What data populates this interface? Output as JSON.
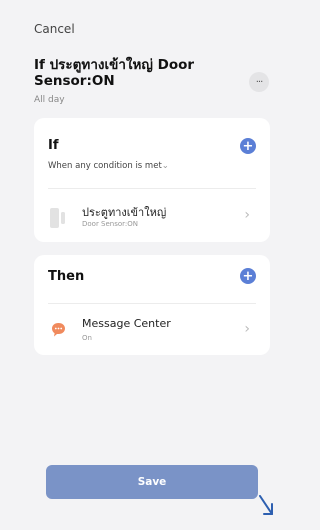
{
  "header": {
    "cancel_label": "Cancel",
    "title": "If ประตูทางเข้าใหญ่ Door Sensor:ON",
    "subtitle": "All day",
    "more_label": "..."
  },
  "if_section": {
    "heading": "If",
    "condition_mode": "When any condition is met",
    "condition_caret": "⌄",
    "items": [
      {
        "title": "ประตูทางเข้าใหญ่",
        "subtitle": "Door Sensor:ON",
        "icon": "door-sensor-icon"
      }
    ]
  },
  "then_section": {
    "heading": "Then",
    "items": [
      {
        "title": "Message Center",
        "subtitle": "On",
        "icon": "message-icon"
      }
    ]
  },
  "save_label": "Save",
  "colors": {
    "accent": "#5b7fd6",
    "save_button": "#7a93c7",
    "message_icon": "#f08a5d",
    "background": "#f3f3f5"
  }
}
